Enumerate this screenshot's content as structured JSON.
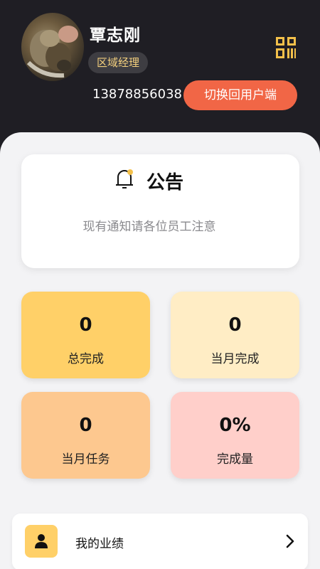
{
  "profile": {
    "name": "覃志刚",
    "role": "区域经理",
    "phone": "13878856038",
    "switch_button_label": "切换回用户端"
  },
  "notice": {
    "title": "公告",
    "message": "现有通知请各位员工注意"
  },
  "stats": [
    {
      "value": "0",
      "label": "总完成",
      "color": "#ffd068"
    },
    {
      "value": "0",
      "label": "当月完成",
      "color": "#ffedc5"
    },
    {
      "value": "0",
      "label": "当月任务",
      "color": "#fdc88f"
    },
    {
      "value": "0%",
      "label": "完成量",
      "color": "#ffcfca"
    }
  ],
  "menu": {
    "performance_label": "我的业绩"
  },
  "colors": {
    "header_bg": "#1f1e24",
    "accent_orange": "#f16646",
    "gold": "#f3cf7d",
    "sheet_bg": "#f3f3f5"
  },
  "icons": {
    "qr": "qr-code-icon",
    "bell": "bell-icon",
    "user": "user-icon",
    "chevron": "chevron-right-icon"
  }
}
